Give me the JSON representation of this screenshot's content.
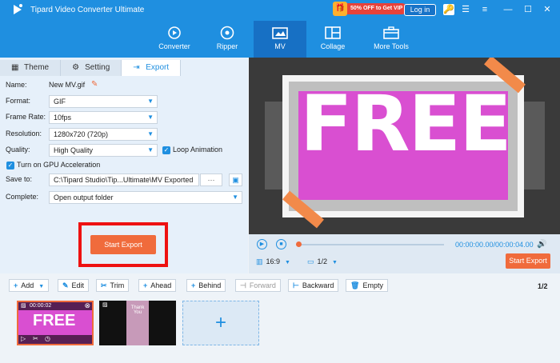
{
  "app": {
    "title": "Tipard Video Converter Ultimate"
  },
  "header": {
    "promo": "50% OFF to Get VIP",
    "login": "Log in"
  },
  "nav": [
    {
      "label": "Converter"
    },
    {
      "label": "Ripper"
    },
    {
      "label": "MV"
    },
    {
      "label": "Collage"
    },
    {
      "label": "More Tools"
    }
  ],
  "tabs": [
    {
      "label": "Theme"
    },
    {
      "label": "Setting"
    },
    {
      "label": "Export"
    }
  ],
  "form": {
    "name_label": "Name:",
    "name_value": "New MV.gif",
    "format_label": "Format:",
    "format_value": "GIF",
    "framerate_label": "Frame Rate:",
    "framerate_value": "10fps",
    "resolution_label": "Resolution:",
    "resolution_value": "1280x720 (720p)",
    "quality_label": "Quality:",
    "quality_value": "High Quality",
    "loop_label": "Loop Animation",
    "gpu_label": "Turn on GPU Acceleration",
    "saveto_label": "Save to:",
    "saveto_value": "C:\\Tipard Studio\\Tip...Ultimate\\MV Exported",
    "browse": "···",
    "complete_label": "Complete:",
    "complete_value": "Open output folder",
    "start_export": "Start Export"
  },
  "preview": {
    "overlay_text": "FREE",
    "time": "00:00:00.00/00:00:04.00",
    "ratio": "16:9",
    "page": "1/2",
    "start_export": "Start Export"
  },
  "toolbar": {
    "add": "Add",
    "edit": "Edit",
    "trim": "Trim",
    "ahead": "Ahead",
    "behind": "Behind",
    "forward": "Forward",
    "backward": "Backward",
    "empty": "Empty",
    "page": "1/2"
  },
  "timeline": {
    "clip1_time": "00:00:02",
    "clip1_text": "FREE",
    "clip2_text": "Thank You"
  },
  "colors": {
    "accent": "#1f8fe0",
    "orange": "#f06b3c",
    "highlight": "#ee1111"
  }
}
